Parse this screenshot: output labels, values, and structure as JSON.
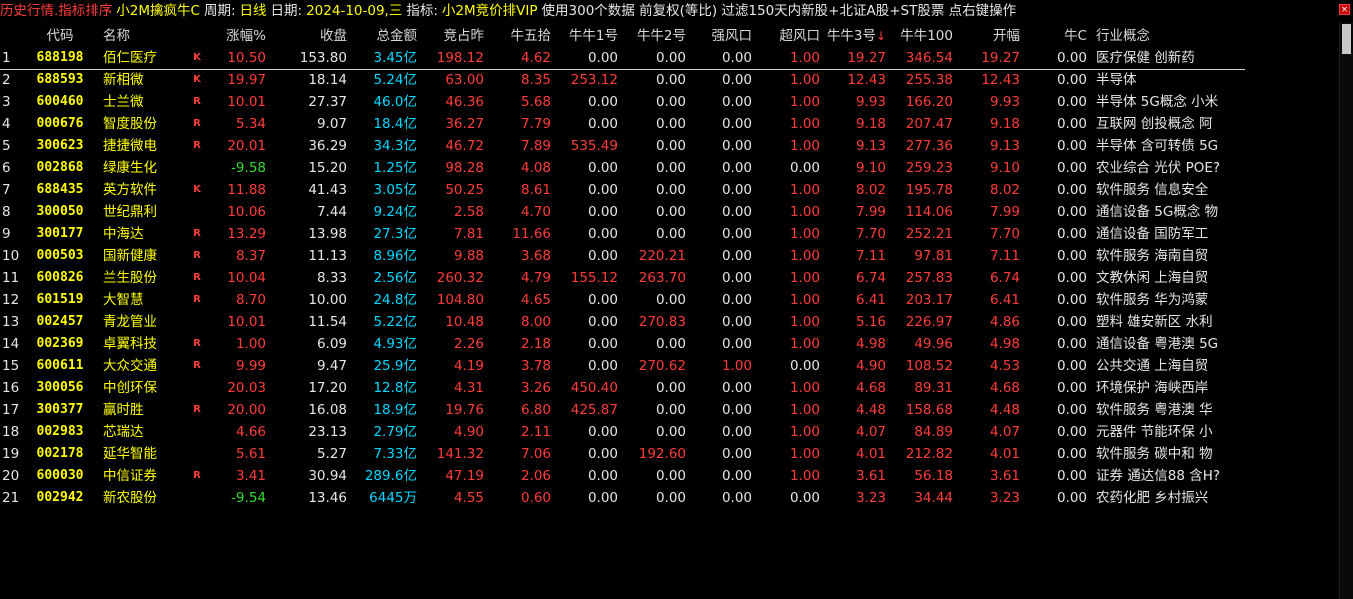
{
  "titlebar": {
    "prefix": "历史行情.指标排序",
    "formula": "小2M擒疯牛C",
    "period_label": "周期:",
    "period_value": "日线",
    "date_label": "日期:",
    "date_value": "2024-10-09,三",
    "indicator_label": "指标:",
    "indicator_value": "小2M竞价排VIP",
    "info": "使用300个数据 前复权(等比) 过滤150天内新股+北证A股+ST股票 点右键操作",
    "close_label": "×"
  },
  "colors": {
    "up": "#ff3c3c",
    "down": "#33dd33",
    "code": "#ffff00",
    "amount": "#00d8ff",
    "background": "#000000"
  },
  "columns": {
    "idx": "",
    "code": "代码",
    "name": "名称",
    "flag": "",
    "zf": "涨幅%",
    "sp": "收盘",
    "zje": "总金额",
    "jzz": "竞占昨",
    "n5s": "牛五拾",
    "n1": "牛牛1号",
    "n2": "牛牛2号",
    "qfk": "强风口",
    "cfk": "超风口",
    "n3": "牛牛3号",
    "n3_sort_icon": "↓",
    "n100": "牛牛100",
    "kf": "开幅",
    "nc": "牛C",
    "ind": "行业概念"
  },
  "rows": [
    {
      "idx": "1",
      "code": "688198",
      "name": "佰仁医疗",
      "flag": "K",
      "zf": "10.50",
      "dir": "up",
      "sp": "153.80",
      "zje": "3.45亿",
      "jzz": "198.12",
      "n5s": "4.62",
      "n1": "0.00",
      "n2": "0.00",
      "qfk": "0.00",
      "cfk": "1.00",
      "n3": "19.27",
      "n100": "346.54",
      "kf": "19.27",
      "nc": "0.00",
      "ind": "医疗保健  创新药"
    },
    {
      "idx": "2",
      "code": "688593",
      "name": "新相微",
      "flag": "K",
      "zf": "19.97",
      "dir": "up",
      "sp": "18.14",
      "zje": "5.24亿",
      "jzz": "63.00",
      "n5s": "8.35",
      "n1": "253.12",
      "n2": "0.00",
      "qfk": "0.00",
      "cfk": "1.00",
      "n3": "12.43",
      "n100": "255.38",
      "kf": "12.43",
      "nc": "0.00",
      "ind": "半导体"
    },
    {
      "idx": "3",
      "code": "600460",
      "name": "士兰微",
      "flag": "R",
      "zf": "10.01",
      "dir": "up",
      "sp": "27.37",
      "zje": "46.0亿",
      "jzz": "46.36",
      "n5s": "5.68",
      "n1": "0.00",
      "n2": "0.00",
      "qfk": "0.00",
      "cfk": "1.00",
      "n3": "9.93",
      "n100": "166.20",
      "kf": "9.93",
      "nc": "0.00",
      "ind": "半导体  5G概念 小米"
    },
    {
      "idx": "4",
      "code": "000676",
      "name": "智度股份",
      "flag": "R",
      "zf": "5.34",
      "dir": "up",
      "sp": "9.07",
      "zje": "18.4亿",
      "jzz": "36.27",
      "n5s": "7.79",
      "n1": "0.00",
      "n2": "0.00",
      "qfk": "0.00",
      "cfk": "1.00",
      "n3": "9.18",
      "n100": "207.47",
      "kf": "9.18",
      "nc": "0.00",
      "ind": "互联网  创投概念 阿"
    },
    {
      "idx": "5",
      "code": "300623",
      "name": "捷捷微电",
      "flag": "R",
      "zf": "20.01",
      "dir": "up",
      "sp": "36.29",
      "zje": "34.3亿",
      "jzz": "46.72",
      "n5s": "7.89",
      "n1": "535.49",
      "n2": "0.00",
      "qfk": "0.00",
      "cfk": "1.00",
      "n3": "9.13",
      "n100": "277.36",
      "kf": "9.13",
      "nc": "0.00",
      "ind": "半导体  含可转债 5G"
    },
    {
      "idx": "6",
      "code": "002868",
      "name": "绿康生化",
      "flag": "",
      "zf": "-9.58",
      "dir": "down",
      "sp": "15.20",
      "zje": "1.25亿",
      "jzz": "98.28",
      "n5s": "4.08",
      "n1": "0.00",
      "n2": "0.00",
      "qfk": "0.00",
      "cfk": "0.00",
      "n3": "9.10",
      "n100": "259.23",
      "kf": "9.10",
      "nc": "0.00",
      "ind": "农业综合  光伏 POE?"
    },
    {
      "idx": "7",
      "code": "688435",
      "name": "英方软件",
      "flag": "K",
      "zf": "11.88",
      "dir": "up",
      "sp": "41.43",
      "zje": "3.05亿",
      "jzz": "50.25",
      "n5s": "8.61",
      "n1": "0.00",
      "n2": "0.00",
      "qfk": "0.00",
      "cfk": "1.00",
      "n3": "8.02",
      "n100": "195.78",
      "kf": "8.02",
      "nc": "0.00",
      "ind": "软件服务  信息安全"
    },
    {
      "idx": "8",
      "code": "300050",
      "name": "世纪鼎利",
      "flag": "",
      "zf": "10.06",
      "dir": "up",
      "sp": "7.44",
      "zje": "9.24亿",
      "jzz": "2.58",
      "n5s": "4.70",
      "n1": "0.00",
      "n2": "0.00",
      "qfk": "0.00",
      "cfk": "1.00",
      "n3": "7.99",
      "n100": "114.06",
      "kf": "7.99",
      "nc": "0.00",
      "ind": "通信设备  5G概念 物"
    },
    {
      "idx": "9",
      "code": "300177",
      "name": "中海达",
      "flag": "R",
      "zf": "13.29",
      "dir": "up",
      "sp": "13.98",
      "zje": "27.3亿",
      "jzz": "7.81",
      "n5s": "11.66",
      "n1": "0.00",
      "n2": "0.00",
      "qfk": "0.00",
      "cfk": "1.00",
      "n3": "7.70",
      "n100": "252.21",
      "kf": "7.70",
      "nc": "0.00",
      "ind": "通信设备  国防军工"
    },
    {
      "idx": "10",
      "code": "000503",
      "name": "国新健康",
      "flag": "R",
      "zf": "8.37",
      "dir": "up",
      "sp": "11.13",
      "zje": "8.96亿",
      "jzz": "9.88",
      "n5s": "3.68",
      "n1": "0.00",
      "n2": "220.21",
      "qfk": "0.00",
      "cfk": "1.00",
      "n3": "7.11",
      "n100": "97.81",
      "kf": "7.11",
      "nc": "0.00",
      "ind": "软件服务  海南自贸"
    },
    {
      "idx": "11",
      "code": "600826",
      "name": "兰生股份",
      "flag": "R",
      "zf": "10.04",
      "dir": "up",
      "sp": "8.33",
      "zje": "2.56亿",
      "jzz": "260.32",
      "n5s": "4.79",
      "n1": "155.12",
      "n2": "263.70",
      "qfk": "0.00",
      "cfk": "1.00",
      "n3": "6.74",
      "n100": "257.83",
      "kf": "6.74",
      "nc": "0.00",
      "ind": "文教休闲  上海自贸"
    },
    {
      "idx": "12",
      "code": "601519",
      "name": "大智慧",
      "flag": "R",
      "zf": "8.70",
      "dir": "up",
      "sp": "10.00",
      "zje": "24.8亿",
      "jzz": "104.80",
      "n5s": "4.65",
      "n1": "0.00",
      "n2": "0.00",
      "qfk": "0.00",
      "cfk": "1.00",
      "n3": "6.41",
      "n100": "203.17",
      "kf": "6.41",
      "nc": "0.00",
      "ind": "软件服务  华为鸿蒙"
    },
    {
      "idx": "13",
      "code": "002457",
      "name": "青龙管业",
      "flag": "",
      "zf": "10.01",
      "dir": "up",
      "sp": "11.54",
      "zje": "5.22亿",
      "jzz": "10.48",
      "n5s": "8.00",
      "n1": "0.00",
      "n2": "270.83",
      "qfk": "0.00",
      "cfk": "1.00",
      "n3": "5.16",
      "n100": "226.97",
      "kf": "4.86",
      "nc": "0.00",
      "ind": "塑料  雄安新区 水利"
    },
    {
      "idx": "14",
      "code": "002369",
      "name": "卓翼科技",
      "flag": "R",
      "zf": "1.00",
      "dir": "up",
      "sp": "6.09",
      "zje": "4.93亿",
      "jzz": "2.26",
      "n5s": "2.18",
      "n1": "0.00",
      "n2": "0.00",
      "qfk": "0.00",
      "cfk": "1.00",
      "n3": "4.98",
      "n100": "49.96",
      "kf": "4.98",
      "nc": "0.00",
      "ind": "通信设备  粤港澳 5G"
    },
    {
      "idx": "15",
      "code": "600611",
      "name": "大众交通",
      "flag": "R",
      "zf": "9.99",
      "dir": "up",
      "sp": "9.47",
      "zje": "25.9亿",
      "jzz": "4.19",
      "n5s": "3.78",
      "n1": "0.00",
      "n2": "270.62",
      "qfk": "1.00",
      "cfk": "0.00",
      "n3": "4.90",
      "n100": "108.52",
      "kf": "4.53",
      "nc": "0.00",
      "ind": "公共交通  上海自贸"
    },
    {
      "idx": "16",
      "code": "300056",
      "name": "中创环保",
      "flag": "",
      "zf": "20.03",
      "dir": "up",
      "sp": "17.20",
      "zje": "12.8亿",
      "jzz": "4.31",
      "n5s": "3.26",
      "n1": "450.40",
      "n2": "0.00",
      "qfk": "0.00",
      "cfk": "1.00",
      "n3": "4.68",
      "n100": "89.31",
      "kf": "4.68",
      "nc": "0.00",
      "ind": "环境保护  海峡西岸"
    },
    {
      "idx": "17",
      "code": "300377",
      "name": "赢时胜",
      "flag": "R",
      "zf": "20.00",
      "dir": "up",
      "sp": "16.08",
      "zje": "18.9亿",
      "jzz": "19.76",
      "n5s": "6.80",
      "n1": "425.87",
      "n2": "0.00",
      "qfk": "0.00",
      "cfk": "1.00",
      "n3": "4.48",
      "n100": "158.68",
      "kf": "4.48",
      "nc": "0.00",
      "ind": "软件服务  粤港澳 华"
    },
    {
      "idx": "18",
      "code": "002983",
      "name": "芯瑞达",
      "flag": "",
      "zf": "4.66",
      "dir": "up",
      "sp": "23.13",
      "zje": "2.79亿",
      "jzz": "4.90",
      "n5s": "2.11",
      "n1": "0.00",
      "n2": "0.00",
      "qfk": "0.00",
      "cfk": "1.00",
      "n3": "4.07",
      "n100": "84.89",
      "kf": "4.07",
      "nc": "0.00",
      "ind": "元器件  节能环保 小"
    },
    {
      "idx": "19",
      "code": "002178",
      "name": "延华智能",
      "flag": "",
      "zf": "5.61",
      "dir": "up",
      "sp": "5.27",
      "zje": "7.33亿",
      "jzz": "141.32",
      "n5s": "7.06",
      "n1": "0.00",
      "n2": "192.60",
      "qfk": "0.00",
      "cfk": "1.00",
      "n3": "4.01",
      "n100": "212.82",
      "kf": "4.01",
      "nc": "0.00",
      "ind": "软件服务  碳中和 物"
    },
    {
      "idx": "20",
      "code": "600030",
      "name": "中信证券",
      "flag": "R",
      "zf": "3.41",
      "dir": "up",
      "sp": "30.94",
      "zje": "289.6亿",
      "jzz": "47.19",
      "n5s": "2.06",
      "n1": "0.00",
      "n2": "0.00",
      "qfk": "0.00",
      "cfk": "1.00",
      "n3": "3.61",
      "n100": "56.18",
      "kf": "3.61",
      "nc": "0.00",
      "ind": "证券  通达信88 含H?"
    },
    {
      "idx": "21",
      "code": "002942",
      "name": "新农股份",
      "flag": "",
      "zf": "-9.54",
      "dir": "down",
      "sp": "13.46",
      "zje": "6445万",
      "jzz": "4.55",
      "n5s": "0.60",
      "n1": "0.00",
      "n2": "0.00",
      "qfk": "0.00",
      "cfk": "0.00",
      "n3": "3.23",
      "n100": "34.44",
      "kf": "3.23",
      "nc": "0.00",
      "ind": "农药化肥  乡村振兴"
    }
  ]
}
